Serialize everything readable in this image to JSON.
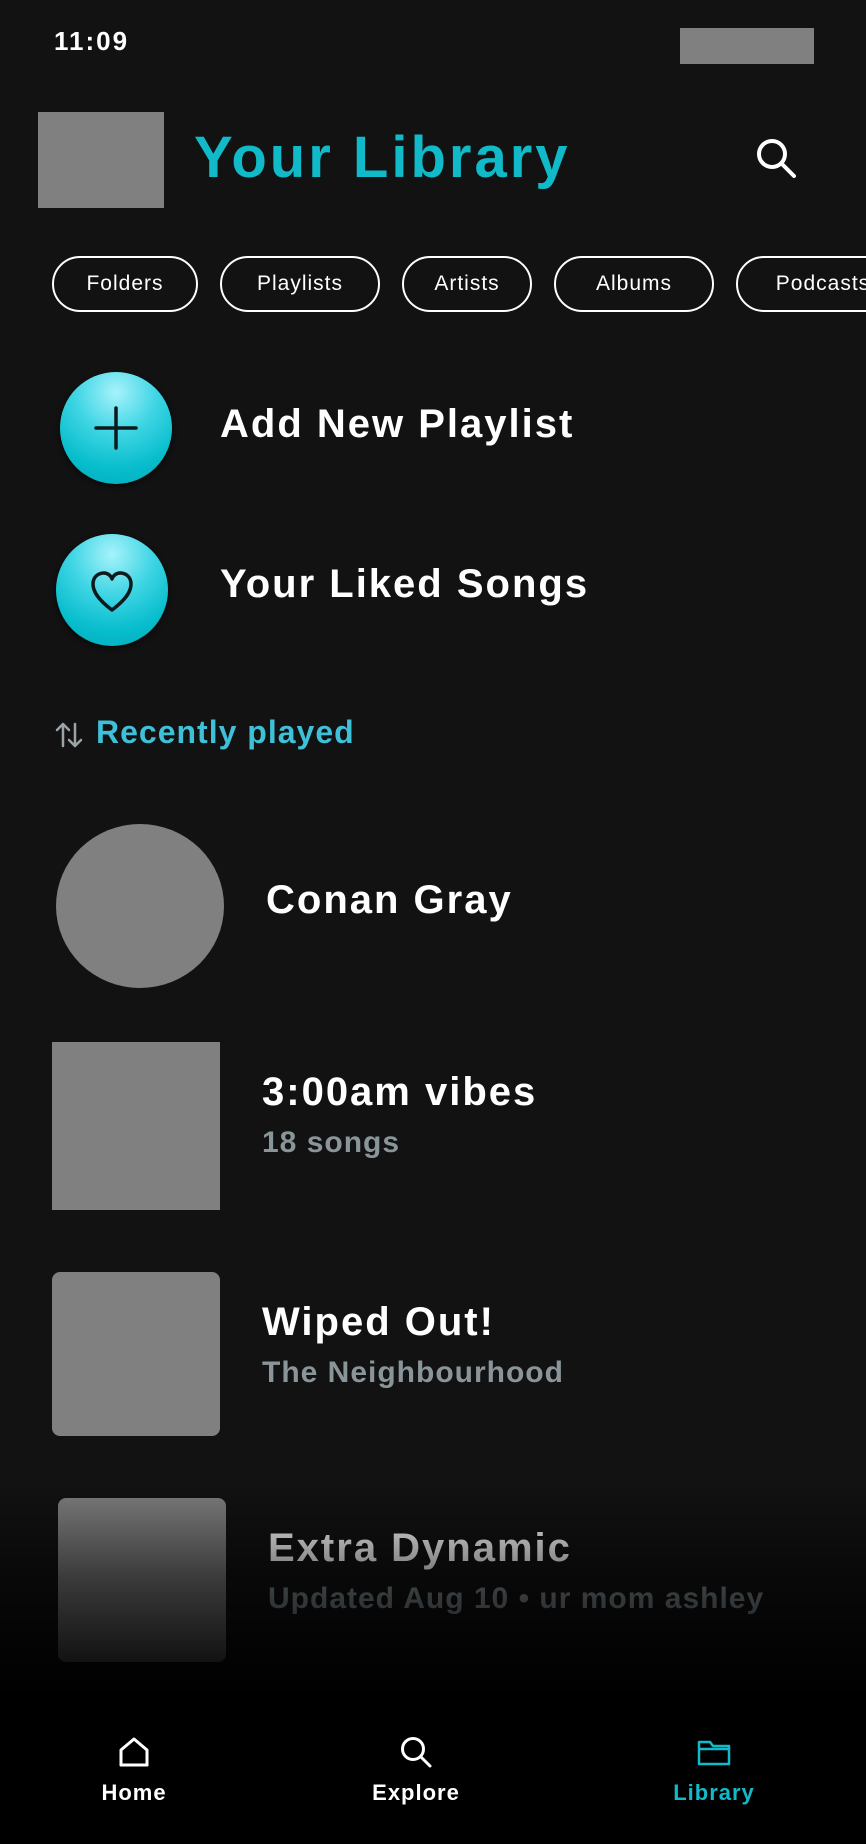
{
  "status": {
    "time": "11:09"
  },
  "header": {
    "title": "Your Library"
  },
  "filters": [
    "Folders",
    "Playlists",
    "Artists",
    "Albums",
    "Podcasts"
  ],
  "actions": {
    "add_playlist": "Add New Playlist",
    "liked_songs": "Your Liked Songs"
  },
  "sort": {
    "label": "Recently played"
  },
  "library_items": [
    {
      "title": "Conan Gray",
      "subtitle": ""
    },
    {
      "title": "3:00am vibes",
      "subtitle": "18 songs"
    },
    {
      "title": "Wiped Out!",
      "subtitle": "The Neighbourhood"
    },
    {
      "title": "Extra Dynamic",
      "subtitle": "Updated Aug 10 • ur mom ashley"
    }
  ],
  "nav": {
    "home": "Home",
    "explore": "Explore",
    "library": "Library"
  },
  "colors": {
    "accent": "#11bac8",
    "background": "#121212",
    "sort_label": "#3ec0d8"
  },
  "icons": {
    "search": "search-icon",
    "add": "plus-icon",
    "liked": "heart-icon",
    "sort": "sort-arrows-icon",
    "home": "home-icon",
    "library": "folder-icon"
  }
}
